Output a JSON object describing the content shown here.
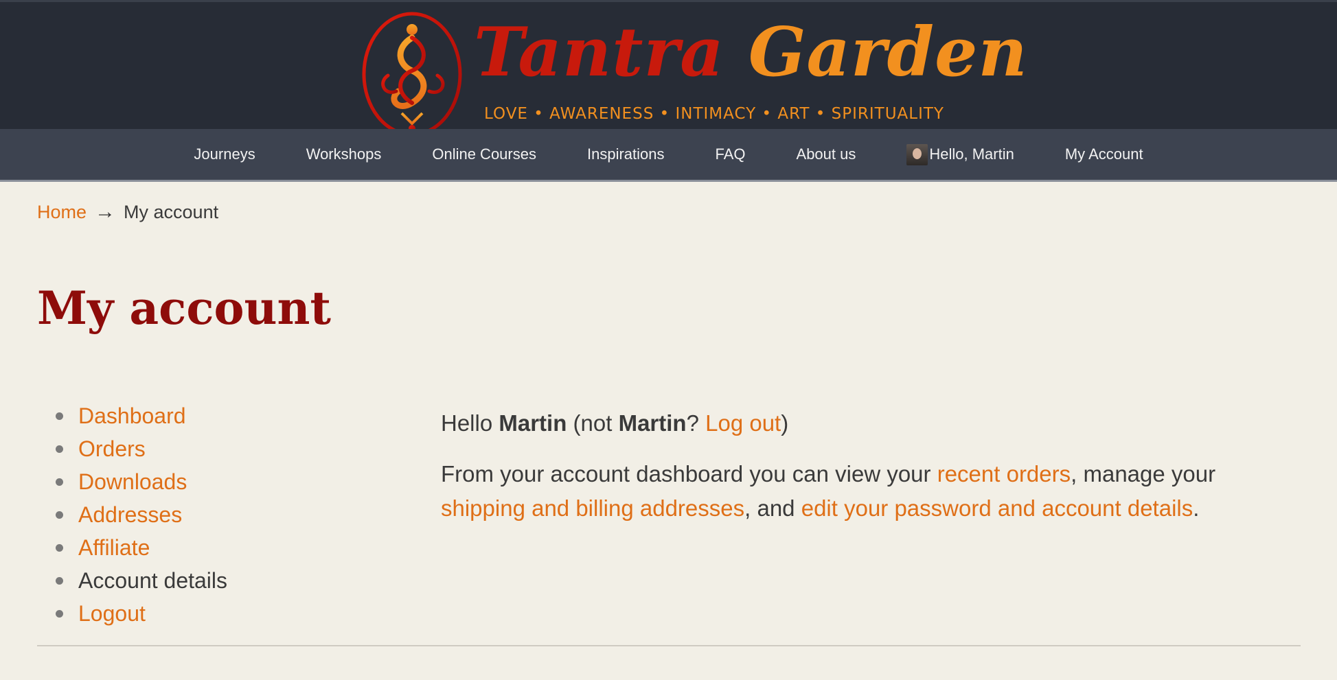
{
  "brand": {
    "title_part1": "Tantra",
    "title_part2": "Garden",
    "tagline": "LOVE • AWARENESS • INTIMACY • ART • SPIRITUALITY",
    "colors": {
      "red": "#c81a0c",
      "orange": "#f2901f",
      "header_bg": "#272c36"
    }
  },
  "nav": {
    "items": [
      {
        "label": "Journeys"
      },
      {
        "label": "Workshops"
      },
      {
        "label": "Online Courses"
      },
      {
        "label": "Inspirations"
      },
      {
        "label": "FAQ"
      },
      {
        "label": "About us"
      },
      {
        "label": "Hello, Martin"
      },
      {
        "label": "My Account"
      }
    ]
  },
  "breadcrumb": {
    "home": "Home",
    "separator": "→",
    "current": "My account"
  },
  "page": {
    "title": "My account"
  },
  "account_nav": {
    "items": [
      {
        "label": "Dashboard"
      },
      {
        "label": "Orders"
      },
      {
        "label": "Downloads"
      },
      {
        "label": "Addresses"
      },
      {
        "label": "Affiliate"
      },
      {
        "label": "Account details"
      },
      {
        "label": "Logout"
      }
    ]
  },
  "dashboard": {
    "hello_prefix": "Hello ",
    "user_name": "Martin",
    "not_prefix": " (not ",
    "not_name": "Martin",
    "question": "? ",
    "logout_link": "Log out",
    "close_paren": ")",
    "intro_text": "From your account dashboard you can view your ",
    "recent_orders_link": "recent orders",
    "mid_text": ", manage your ",
    "addresses_link": "shipping and billing addresses",
    "and_text": ", and ",
    "account_link": "edit your password and account details",
    "end_text": "."
  },
  "link_color": "#df6f17",
  "title_color": "#8e0c0a"
}
